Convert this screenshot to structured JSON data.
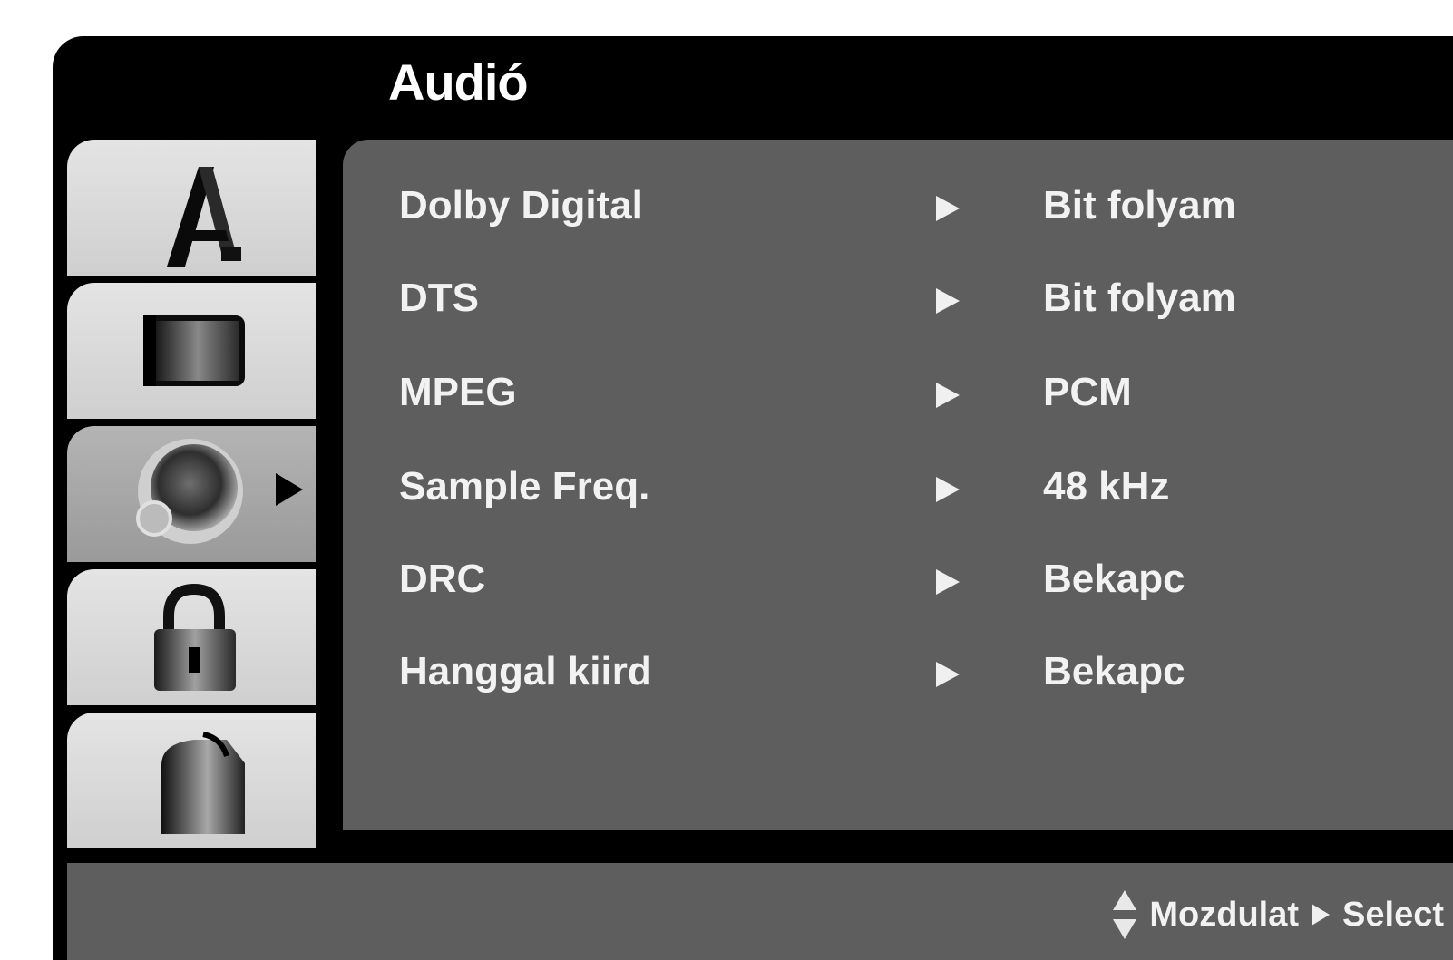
{
  "menu": {
    "title": "Audió"
  },
  "tabs": [
    {
      "icon": "language-icon",
      "active": false
    },
    {
      "icon": "display-icon",
      "active": false
    },
    {
      "icon": "audio-icon",
      "active": true
    },
    {
      "icon": "lock-icon",
      "active": false
    },
    {
      "icon": "others-icon",
      "active": false
    }
  ],
  "settings": [
    {
      "label": "Dolby Digital",
      "value": "Bit folyam"
    },
    {
      "label": "DTS",
      "value": "Bit folyam"
    },
    {
      "label": "MPEG",
      "value": "PCM"
    },
    {
      "label": "Sample Freq.",
      "value": "48 kHz"
    },
    {
      "label": "DRC",
      "value": "Bekapc"
    },
    {
      "label": "Hanggal kiird",
      "value": "Bekapc"
    }
  ],
  "help": {
    "move_label": "Mozdulat",
    "select_label": "Select"
  },
  "colors": {
    "frame": "#000000",
    "panel": "#5e5e5e",
    "tab": "#dcdcdc",
    "tab_active": "#a8a8a8",
    "text": "#f2f2f2"
  }
}
